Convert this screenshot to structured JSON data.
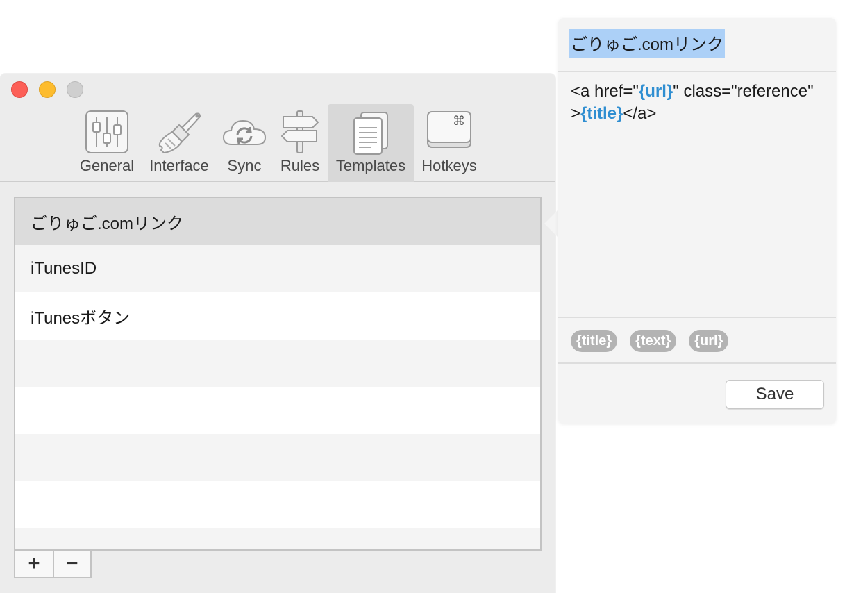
{
  "window": {
    "toolbar": [
      {
        "id": "general",
        "label": "General",
        "icon": "sliders-icon",
        "active": false
      },
      {
        "id": "interface",
        "label": "Interface",
        "icon": "paintbrush-icon",
        "active": false
      },
      {
        "id": "sync",
        "label": "Sync",
        "icon": "cloud-sync-icon",
        "active": false
      },
      {
        "id": "rules",
        "label": "Rules",
        "icon": "signpost-icon",
        "active": false
      },
      {
        "id": "templates",
        "label": "Templates",
        "icon": "documents-icon",
        "active": true
      },
      {
        "id": "hotkeys",
        "label": "Hotkeys",
        "icon": "command-key-icon",
        "active": false
      }
    ],
    "hotkey_glyph": "⌘"
  },
  "templates": {
    "items": [
      "ごりゅご.comリンク",
      "iTunesID",
      "iTunesボタン"
    ],
    "selected_index": 0,
    "add_label": "+",
    "remove_label": "−"
  },
  "editor": {
    "title": "ごりゅご.comリンク",
    "code": {
      "p1": "<a href=\"",
      "t1": "{url}",
      "p2": "\" class=\"reference\" >",
      "t2": "{title}",
      "p3": "</a>"
    },
    "chips": [
      "{title}",
      "{text}",
      "{url}"
    ],
    "save_label": "Save"
  },
  "colors": {
    "accent_token": "#2f8ed1",
    "selection": "#acd0f7",
    "close": "#fc5f57",
    "minimize": "#fdbc2e",
    "zoom": "#cfcfcf"
  }
}
